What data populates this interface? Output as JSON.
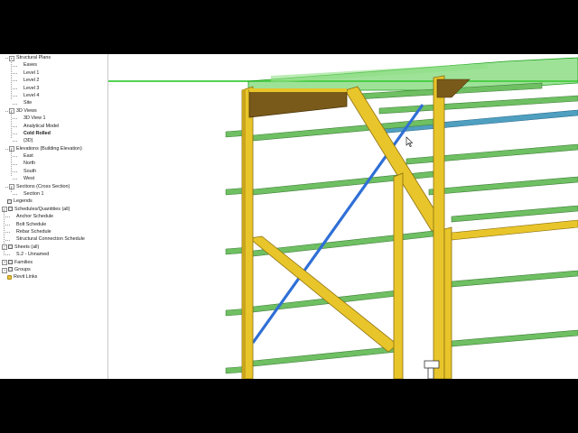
{
  "project_browser": {
    "items": [
      {
        "label": "Structural Plans",
        "level": 1,
        "toggle": "−"
      },
      {
        "label": "Eaves",
        "level": 2
      },
      {
        "label": "Level 1",
        "level": 2
      },
      {
        "label": "Level 2",
        "level": 2
      },
      {
        "label": "Level 3",
        "level": 2
      },
      {
        "label": "Level 4",
        "level": 2
      },
      {
        "label": "Site",
        "level": 2
      },
      {
        "label": "3D Views",
        "level": 1,
        "toggle": "−"
      },
      {
        "label": "3D View 1",
        "level": 2
      },
      {
        "label": "Analytical Model",
        "level": 2
      },
      {
        "label": "Cold Rolled",
        "level": 2,
        "bold": true
      },
      {
        "label": "{3D}",
        "level": 2
      },
      {
        "label": "Elevations (Building Elevation)",
        "level": 1,
        "toggle": "−"
      },
      {
        "label": "East",
        "level": 2
      },
      {
        "label": "North",
        "level": 2
      },
      {
        "label": "South",
        "level": 2
      },
      {
        "label": "West",
        "level": 2
      },
      {
        "label": "Sections (Cross Section)",
        "level": 1,
        "toggle": "−"
      },
      {
        "label": "Section 1",
        "level": 2
      },
      {
        "label": "Legends",
        "level": 0,
        "icon": "legend-icon"
      },
      {
        "label": "Schedules/Quantities (all)",
        "level": 0,
        "toggle": "−",
        "icon": "schedule-icon"
      },
      {
        "label": "Anchor Schedule",
        "level": 1
      },
      {
        "label": "Bolt Schedule",
        "level": 1
      },
      {
        "label": "Rebar Schedule",
        "level": 1
      },
      {
        "label": "Structural Connection Schedule",
        "level": 1
      },
      {
        "label": "Sheets (all)",
        "level": 0,
        "toggle": "−",
        "icon": "sheet-icon"
      },
      {
        "label": "S.2 - Unnamed",
        "level": 1
      },
      {
        "label": "Families",
        "level": 0,
        "toggle": "+",
        "icon": "family-icon"
      },
      {
        "label": "Groups",
        "level": 0,
        "toggle": "+",
        "icon": "group-icon"
      },
      {
        "label": "Revit Links",
        "level": 0,
        "icon": "link-icon"
      }
    ]
  },
  "colors": {
    "steel_yellow": "#e8c52a",
    "purlin_green": "#6fbf63",
    "brace_blue": "#2f6fd6",
    "selection_green": "#19c419",
    "haunch_brown": "#7a5a1a"
  }
}
